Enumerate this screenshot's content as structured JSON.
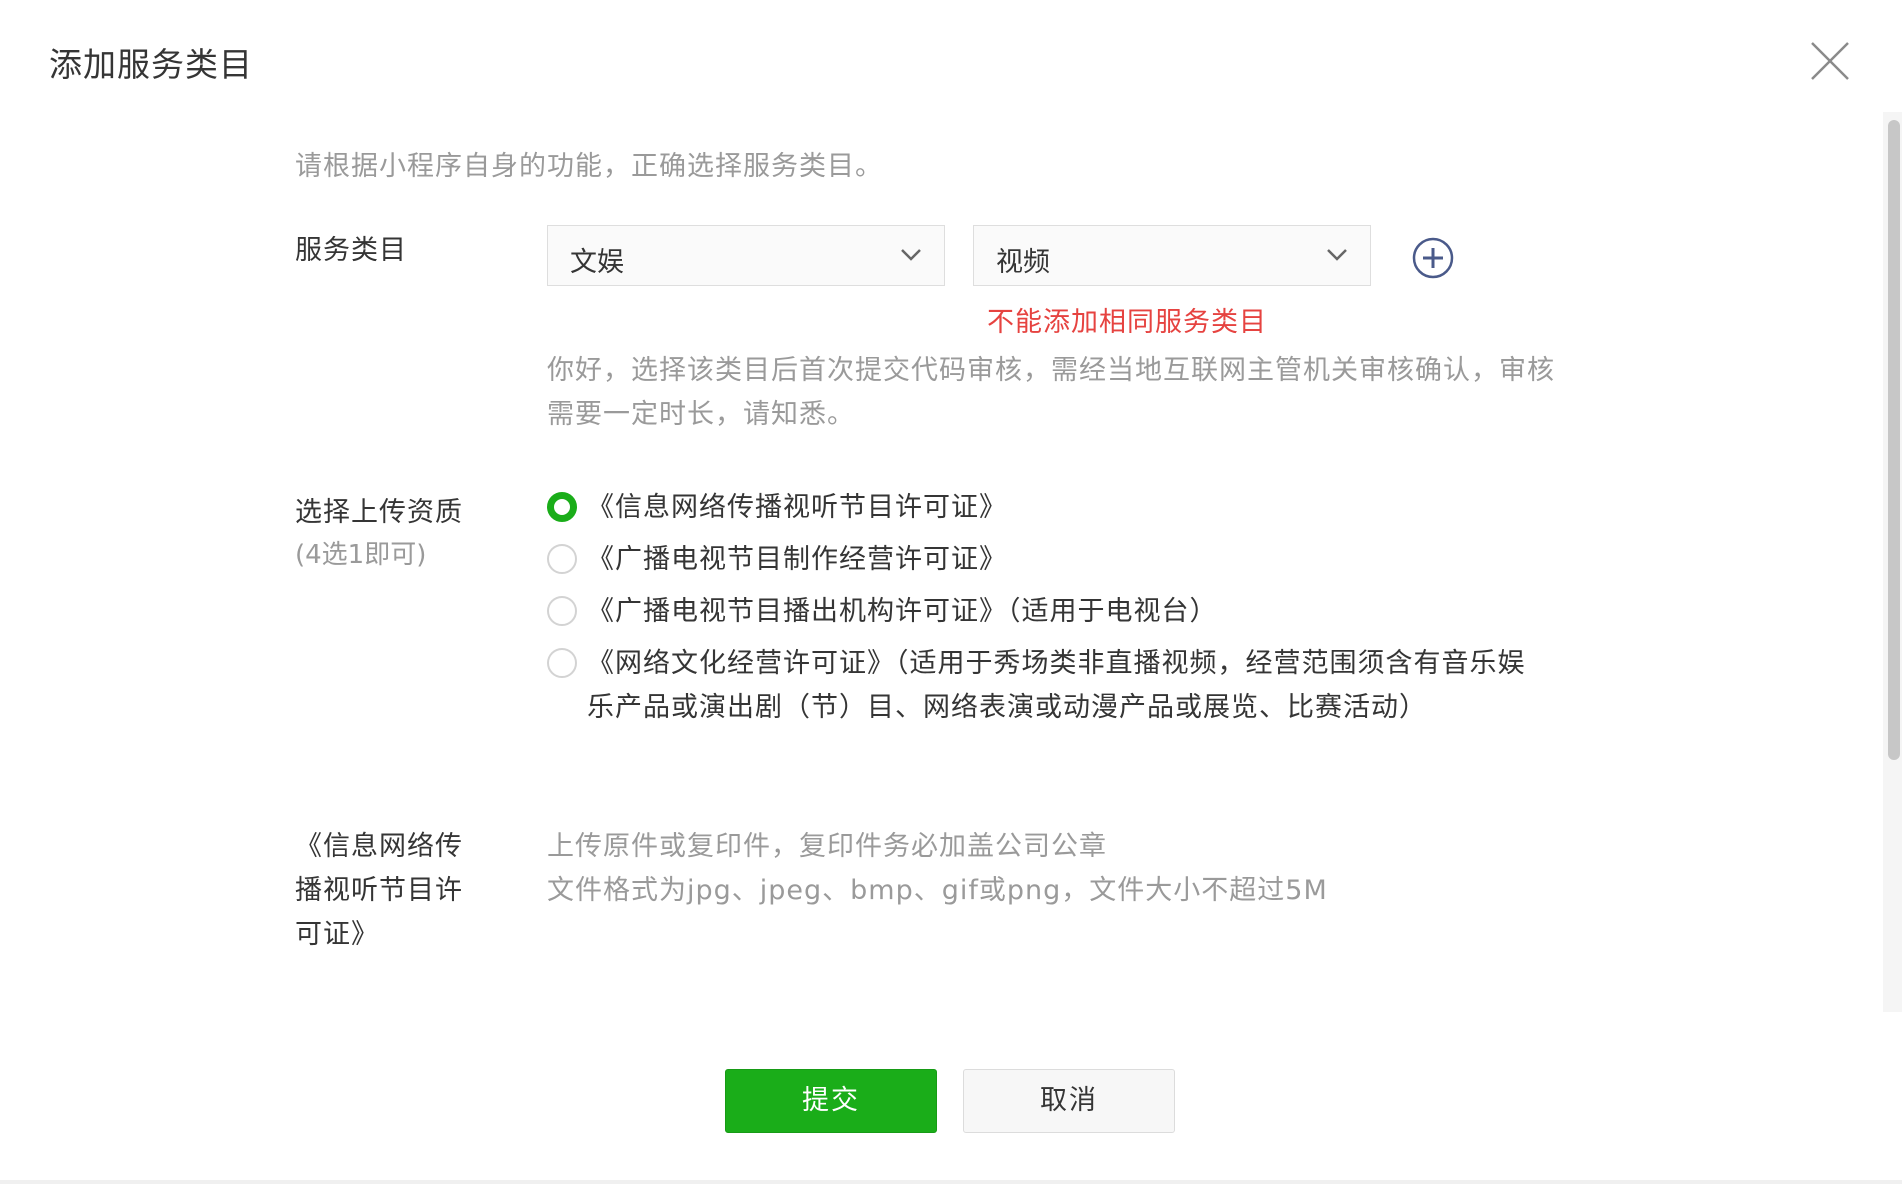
{
  "dialog": {
    "title": "添加服务类目"
  },
  "form": {
    "hint": "请根据小程序自身的功能，正确选择服务类目。",
    "category_label": "服务类目",
    "category_primary": "文娱",
    "category_secondary": "视频",
    "error": "不能添加相同服务类目",
    "description": "你好，选择该类目后首次提交代码审核，需经当地互联网主管机关审核确认，审核需要一定时长，请知悉。",
    "qualification_label": "选择上传资质",
    "qualification_sublabel": "(4选1即可)",
    "qualifications": [
      {
        "label": "《信息网络传播视听节目许可证》",
        "checked": true
      },
      {
        "label": "《广播电视节目制作经营许可证》",
        "checked": false
      },
      {
        "label": "《广播电视节目播出机构许可证》（适用于电视台）",
        "checked": false
      },
      {
        "label": "《网络文化经营许可证》（适用于秀场类非直播视频，经营范围须含有音乐娱乐产品或演出剧（节）目、网络表演或动漫产品或展览、比赛活动）",
        "checked": false
      }
    ],
    "upload_label": "《信息网络传播视听节目许可证》",
    "upload_hint_line1": "上传原件或复印件，复印件务必加盖公司公章",
    "upload_hint_line2": "文件格式为jpg、jpeg、bmp、gif或png，文件大小不超过5M"
  },
  "footer": {
    "submit_label": "提交",
    "cancel_label": "取消"
  },
  "colors": {
    "accent": "#1aad19",
    "error": "#e64340",
    "add_icon": "#4a5a8a"
  },
  "icons": {
    "close": "close-icon",
    "chevron": "chevron-down-icon",
    "add": "plus-circle-icon"
  }
}
